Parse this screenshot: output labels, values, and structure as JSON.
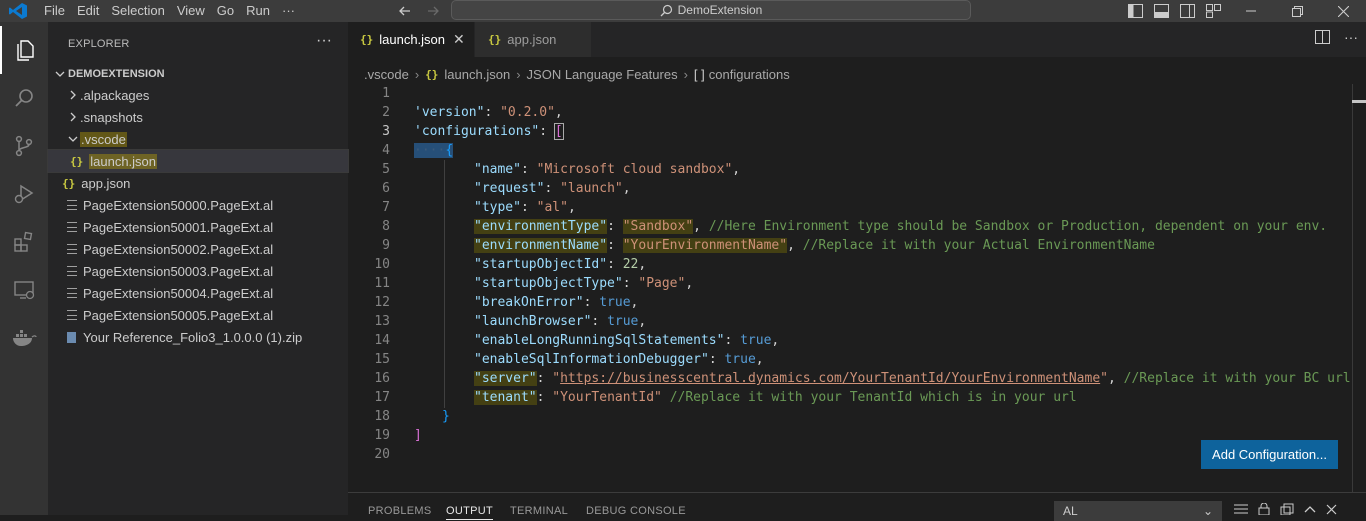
{
  "titlebar": {
    "menu": [
      "File",
      "Edit",
      "Selection",
      "View",
      "Go",
      "Run",
      "···"
    ],
    "search_text": "DemoExtension"
  },
  "sidebar": {
    "title": "EXPLORER",
    "more": "···",
    "folder": "DEMOEXTENSION",
    "items": [
      {
        "label": ".alpackages",
        "kind": "folder-collapsed"
      },
      {
        "label": ".snapshots",
        "kind": "folder-collapsed"
      },
      {
        "label": ".vscode",
        "kind": "folder-open",
        "highlight": true
      },
      {
        "label": "launch.json",
        "kind": "json",
        "selected": true,
        "highlight": true
      },
      {
        "label": "app.json",
        "kind": "json"
      },
      {
        "label": "PageExtension50000.PageExt.al",
        "kind": "al"
      },
      {
        "label": "PageExtension50001.PageExt.al",
        "kind": "al"
      },
      {
        "label": "PageExtension50002.PageExt.al",
        "kind": "al"
      },
      {
        "label": "PageExtension50003.PageExt.al",
        "kind": "al"
      },
      {
        "label": "PageExtension50004.PageExt.al",
        "kind": "al"
      },
      {
        "label": "PageExtension50005.PageExt.al",
        "kind": "al"
      },
      {
        "label": "Your Reference_Folio3_1.0.0.0 (1).zip",
        "kind": "zip"
      }
    ]
  },
  "tabs": [
    {
      "label": "launch.json",
      "icon": "{}",
      "active": true,
      "close": "✕"
    },
    {
      "label": "app.json",
      "icon": "{}",
      "active": false
    }
  ],
  "breadcrumb": [
    ".vscode",
    "launch.json",
    "JSON Language Features",
    "configurations"
  ],
  "breadcrumb_icons": {
    "json": "{}",
    "array": "[ ]"
  },
  "editor": {
    "line_numbers": [
      "1",
      "2",
      "3",
      "4",
      "5",
      "6",
      "7",
      "8",
      "9",
      "10",
      "11",
      "12",
      "13",
      "14",
      "15",
      "16",
      "17",
      "18",
      "19",
      "20"
    ],
    "lines": {
      "l2_key": "'version\"",
      "l2_val": "\"0.2.0\"",
      "l3_key": "'configurations\"",
      "l5_key": "\"name\"",
      "l5_val": "\"Microsoft cloud sandbox\"",
      "l6_key": "\"request\"",
      "l6_val": "\"launch\"",
      "l7_key": "\"type\"",
      "l7_val": "\"al\"",
      "l8_key": "\"environmentType\"",
      "l8_val": "\"Sandbox\"",
      "l8_comment": "//Here Environment type should be Sandbox or Production, dependent on your env.",
      "l9_key": "\"environmentName\"",
      "l9_val": "\"YourEnvironmentName\"",
      "l9_comment": "//Replace it with your Actual EnvironmentName",
      "l10_key": "\"startupObjectId\"",
      "l10_val": "22",
      "l11_key": "\"startupObjectType\"",
      "l11_val": "\"Page\"",
      "l12_key": "\"breakOnError\"",
      "l12_val": "true",
      "l13_key": "\"launchBrowser\"",
      "l13_val": "true",
      "l14_key": "\"enableLongRunningSqlStatements\"",
      "l14_val": "true",
      "l15_key": "\"enableSqlInformationDebugger\"",
      "l15_val": "true",
      "l16_key": "\"server\"",
      "l16_val_q": "\"",
      "l16_url": "https://businesscentral.dynamics.com/YourTenantId/YourEnvironmentName",
      "l16_comment": "//Replace it with your BC url",
      "l17_key": "\"tenant\"",
      "l17_val": "\"YourTenantId\"",
      "l17_comment": "//Replace it with your TenantId which is in your url"
    },
    "add_configuration": "Add Configuration..."
  },
  "panel": {
    "tabs": [
      "PROBLEMS",
      "OUTPUT",
      "TERMINAL",
      "DEBUG CONSOLE"
    ],
    "active_tab": "OUTPUT",
    "select_value": "AL"
  }
}
